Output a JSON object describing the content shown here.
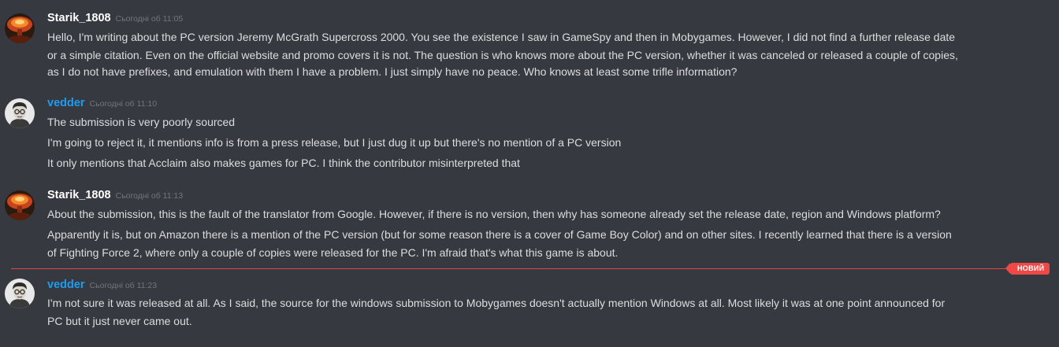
{
  "new_badge": "НОВИЙ",
  "colors": {
    "background": "#36393f",
    "text": "#dcddde",
    "username_starik": "#ffffff",
    "username_vedder": "#1e9cf0",
    "timestamp": "#72767d",
    "new_divider": "#f04747"
  },
  "groups": [
    {
      "author": "Starik_1808",
      "avatar_icon": "explosion-avatar-icon",
      "timestamp": "Сьогодні об 11:05",
      "messages": [
        "Hello, I'm writing about the PC version Jeremy McGrath Supercross 2000. You see the existence I saw in GameSpy and then in Mobygames. However, I did not find a further release date",
        "or a simple citation. Even on the official website and promo covers it is not. The question is who knows more about the PC version, whether it was canceled or released a couple of copies,",
        "as I do not have prefixes, and emulation with them I have a problem. I just simply have no peace. Who knows at least some trifle information?"
      ]
    },
    {
      "author": "vedder",
      "avatar_icon": "portrait-avatar-icon",
      "timestamp": "Сьогодні об 11:10",
      "messages": [
        "The submission is very poorly sourced",
        "I'm going to reject it, it mentions info is from a press release, but I just dug it up but there's no mention of a PC version",
        "It only mentions that Acclaim also makes games for PC. I think the contributor misinterpreted that"
      ]
    },
    {
      "author": "Starik_1808",
      "avatar_icon": "explosion-avatar-icon",
      "timestamp": "Сьогодні об 11:13",
      "messages": [
        "About the submission, this is the fault of the translator from Google. However, if there is no version, then why has someone already set the release date, region and Windows platform?",
        "Apparently it is, but on Amazon there is a mention of the PC version (but for some reason there is a cover of Game Boy Color) and on other sites. I recently learned that there is a version",
        "of Fighting Force 2, where only a couple of copies were released for the PC. I'm afraid that's what this game is about."
      ]
    },
    {
      "author": "vedder",
      "avatar_icon": "portrait-avatar-icon",
      "timestamp": "Сьогодні об 11:23",
      "messages": [
        "I'm not sure it was released at all. As I said, the source for the windows submission to Mobygames doesn't actually mention Windows at all. Most likely it was at one point announced for",
        "PC but it just never came out."
      ]
    }
  ]
}
